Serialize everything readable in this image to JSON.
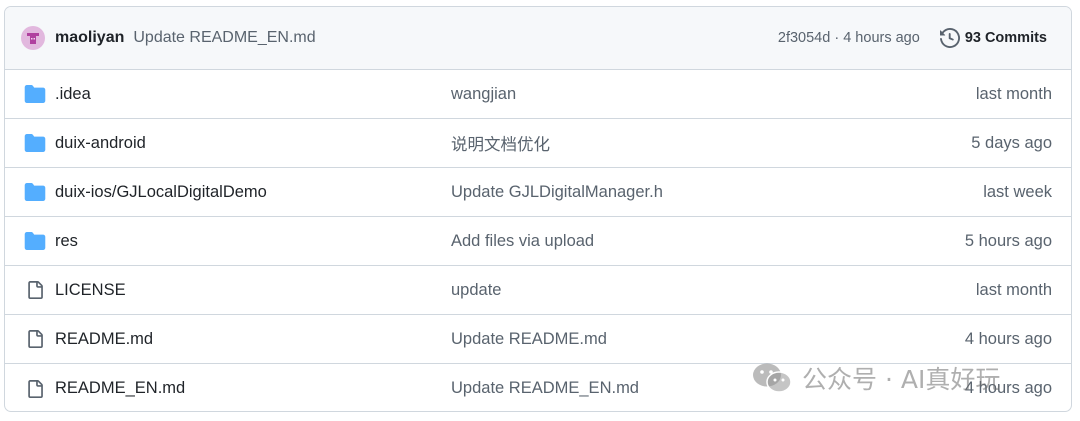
{
  "commit_header": {
    "author": "maoliyan",
    "message": "Update README_EN.md",
    "hash": "2f3054d",
    "separator": "·",
    "time": "4 hours ago",
    "commits_count": "93",
    "commits_label": "Commits",
    "avatar_icon": "identicon-avatar",
    "history_icon": "history-icon"
  },
  "files": [
    {
      "type": "folder",
      "icon": "folder-icon",
      "name": ".idea",
      "commit": "wangjian",
      "time": "last month"
    },
    {
      "type": "folder",
      "icon": "folder-icon",
      "name": "duix-android",
      "commit": "说明文档优化",
      "time": "5 days ago"
    },
    {
      "type": "folder",
      "icon": "folder-icon",
      "name": "duix-ios/GJLocalDigitalDemo",
      "commit": "Update GJLDigitalManager.h",
      "time": "last week"
    },
    {
      "type": "folder",
      "icon": "folder-icon",
      "name": "res",
      "commit": "Add files via upload",
      "time": "5 hours ago"
    },
    {
      "type": "file",
      "icon": "file-icon",
      "name": "LICENSE",
      "commit": "update",
      "time": "last month"
    },
    {
      "type": "file",
      "icon": "file-icon",
      "name": "README.md",
      "commit": "Update README.md",
      "time": "4 hours ago"
    },
    {
      "type": "file",
      "icon": "file-icon",
      "name": "README_EN.md",
      "commit": "Update README_EN.md",
      "time": "4 hours ago"
    }
  ],
  "watermark": {
    "text": "公众号 · AI真好玩",
    "icon": "wechat-icon"
  },
  "colors": {
    "folder": "#54aeff",
    "file_icon": "#59636e",
    "header_bg": "#f6f8fa",
    "border": "#d0d7de",
    "muted_text": "#59636e",
    "avatar": "#e2b8de"
  }
}
